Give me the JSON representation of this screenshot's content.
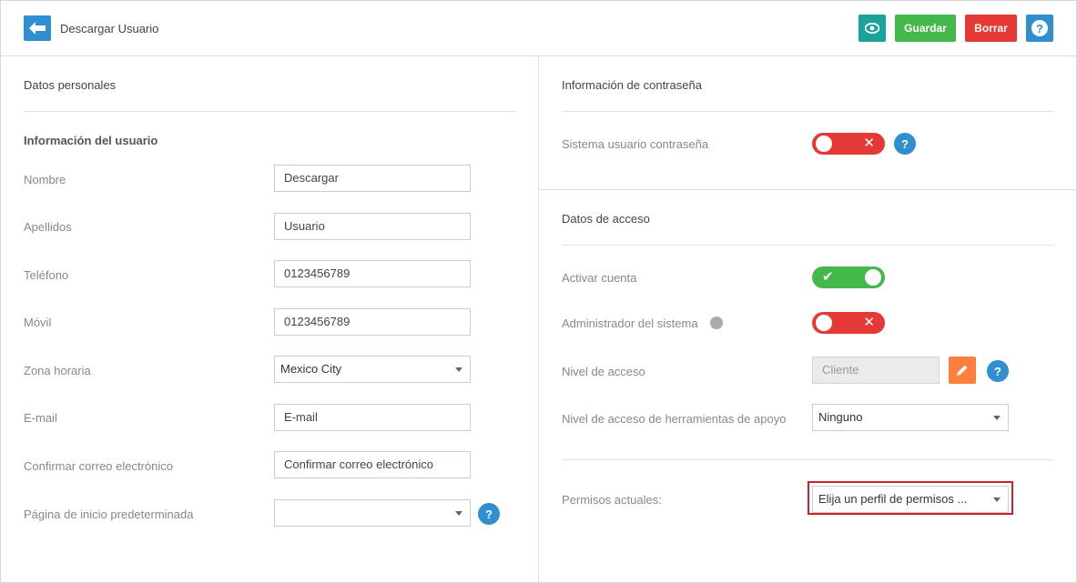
{
  "header": {
    "title": "Descargar Usuario",
    "save_label": "Guardar",
    "delete_label": "Borrar",
    "help_label": "?",
    "icons": {
      "back": "arrow-left-icon",
      "view": "eye-icon"
    }
  },
  "left": {
    "section_title": "Datos personales",
    "subheading": "Información del usuario",
    "fields": {
      "nombre": {
        "label": "Nombre",
        "value": "Descargar"
      },
      "apellidos": {
        "label": "Apellidos",
        "value": "Usuario"
      },
      "telefono": {
        "label": "Teléfono",
        "value": "0123456789"
      },
      "movil": {
        "label": "Móvil",
        "value": "0123456789"
      },
      "zona": {
        "label": "Zona horaria",
        "value": "Mexico City"
      },
      "email": {
        "label": "E-mail",
        "placeholder": "E-mail"
      },
      "confirmar": {
        "label": "Confirmar correo electrónico",
        "placeholder": "Confirmar correo electrónico"
      },
      "pagina": {
        "label": "Página de inicio predeterminada",
        "value": ""
      }
    },
    "help_label": "?"
  },
  "right_top": {
    "section_title": "Información de contraseña",
    "sistema_label": "Sistema usuario contraseña",
    "sistema_state": "off",
    "help_label": "?"
  },
  "right_bottom": {
    "section_title": "Datos de acceso",
    "activar_label": "Activar cuenta",
    "activar_state": "on",
    "admin_label": "Administrador del sistema",
    "admin_state": "off",
    "nivel_label": "Nivel de acceso",
    "nivel_value": "Cliente",
    "herramientas_label": "Nivel de acceso de herramientas de apoyo",
    "herramientas_value": "Ninguno",
    "permisos_label": "Permisos actuales:",
    "permisos_value": "Elija un perfil de permisos ...",
    "help_label": "?"
  },
  "colors": {
    "primary": "#2f8fd1",
    "teal": "#1aa39a",
    "success": "#44b84b",
    "danger": "#e53935",
    "orange": "#ff7f3f",
    "highlight": "#d0202a"
  }
}
